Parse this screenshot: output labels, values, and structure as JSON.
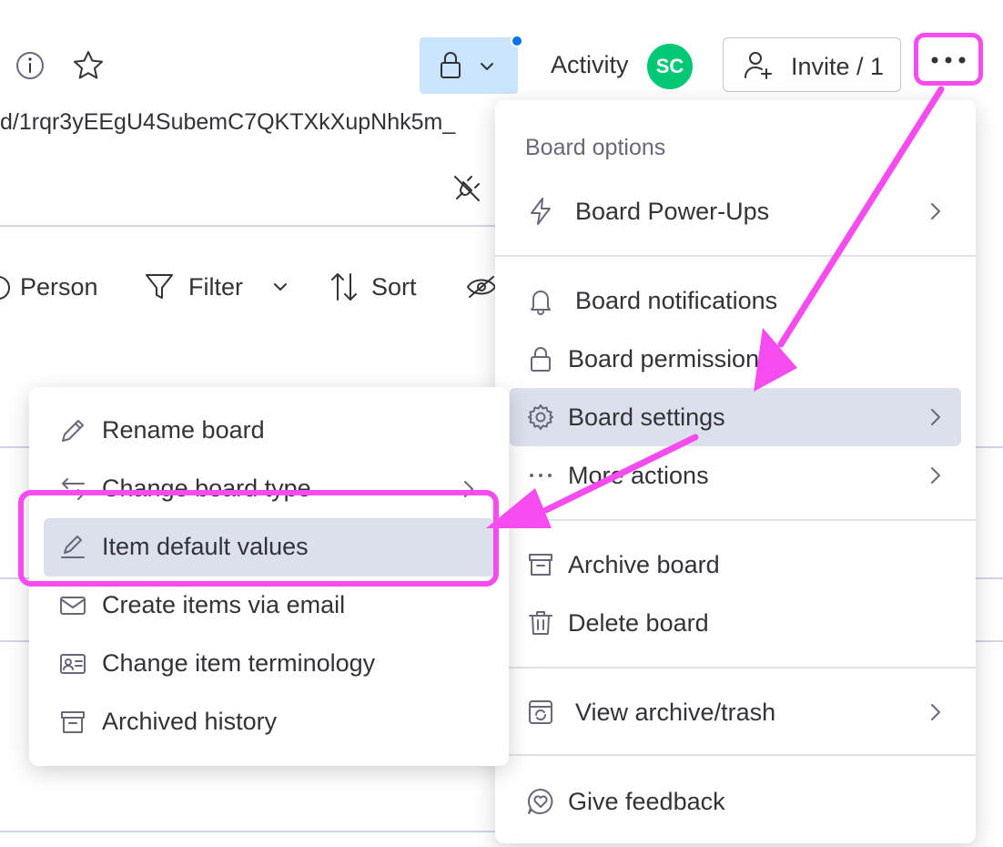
{
  "header": {
    "activity_label": "Activity",
    "avatar_initials": "SC",
    "invite_label": "Invite / 1",
    "url_fragment": "d/1rqr3yEEgU4SubemC7QKTXkXupNhk5m_"
  },
  "toolbar": {
    "person_label": "Person",
    "filter_label": "Filter",
    "sort_label": "Sort"
  },
  "board_options_menu": {
    "header": "Board options",
    "items": [
      {
        "label": "Board Power-Ups",
        "icon": "lightning-icon",
        "has_submenu": true
      },
      {
        "label": "Board notifications",
        "icon": "bell-icon",
        "has_submenu": false
      },
      {
        "label": "Board permissions",
        "icon": "lock-icon",
        "has_submenu": false
      },
      {
        "label": "Board settings",
        "icon": "gear-icon",
        "has_submenu": true,
        "active": true
      },
      {
        "label": "More actions",
        "icon": "dots-icon",
        "has_submenu": true
      },
      {
        "label": "Archive board",
        "icon": "archive-icon",
        "has_submenu": false
      },
      {
        "label": "Delete board",
        "icon": "trash-icon",
        "has_submenu": false
      },
      {
        "label": "View archive/trash",
        "icon": "archive-restore-icon",
        "has_submenu": true
      },
      {
        "label": "Give feedback",
        "icon": "heart-chat-icon",
        "has_submenu": false
      }
    ]
  },
  "board_settings_submenu": {
    "items": [
      {
        "label": "Rename board",
        "icon": "pencil-icon"
      },
      {
        "label": "Change board type",
        "icon": "swap-arrows-icon",
        "has_submenu": true
      },
      {
        "label": "Item default values",
        "icon": "edit-pen-icon",
        "active": true
      },
      {
        "label": "Create items via email",
        "icon": "envelope-icon"
      },
      {
        "label": "Change item terminology",
        "icon": "id-card-icon"
      },
      {
        "label": "Archived history",
        "icon": "archive-box-icon"
      }
    ]
  },
  "colors": {
    "accent_highlight": "#f54bef",
    "avatar_bg": "#00c875",
    "lock_btn_bg": "#cce5ff",
    "active_item_bg": "#dcdfec",
    "primary_blue": "#0073ea"
  }
}
